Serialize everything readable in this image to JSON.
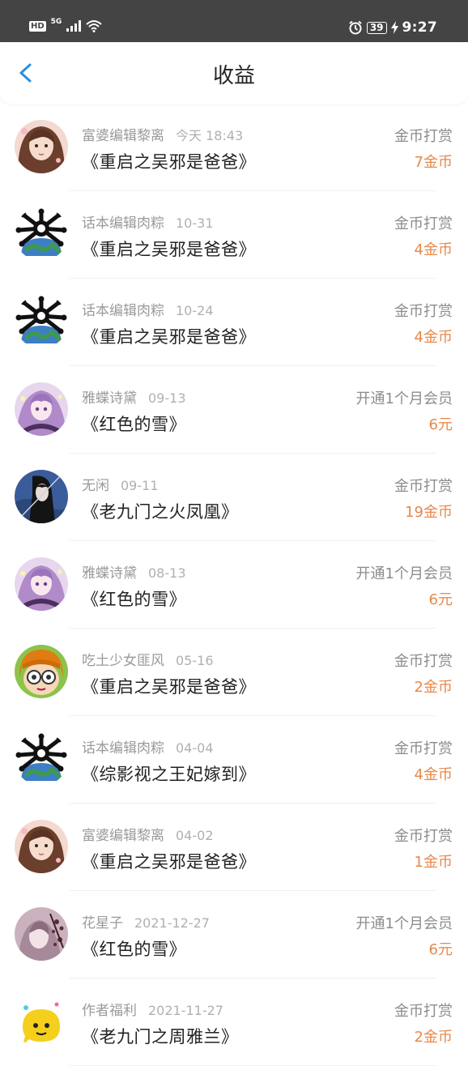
{
  "status_bar": {
    "hd": "HD",
    "network": "5G",
    "battery": "39",
    "time": "9:27"
  },
  "header": {
    "title": "收益"
  },
  "records": [
    {
      "name": "富婆编辑黎离",
      "date": "今天 18:43",
      "book": "《重启之吴邪是爸爸》",
      "type": "金币打赏",
      "amount": "7金币",
      "avatar": "portrait-girl"
    },
    {
      "name": "话本编辑肉粽",
      "date": "10-31",
      "book": "《重启之吴邪是爸爸》",
      "type": "金币打赏",
      "amount": "4金币",
      "avatar": "globe-skull"
    },
    {
      "name": "话本编辑肉粽",
      "date": "10-24",
      "book": "《重启之吴邪是爸爸》",
      "type": "金币打赏",
      "amount": "4金币",
      "avatar": "globe-skull"
    },
    {
      "name": "雅蝶诗黛",
      "date": "09-13",
      "book": "《红色的雪》",
      "type": "开通1个月会员",
      "amount": "6元",
      "avatar": "purple-anime"
    },
    {
      "name": "无闲",
      "date": "09-11",
      "book": "《老九门之火凤凰》",
      "type": "金币打赏",
      "amount": "19金币",
      "avatar": "dark-swordsman"
    },
    {
      "name": "雅蝶诗黛",
      "date": "08-13",
      "book": "《红色的雪》",
      "type": "开通1个月会员",
      "amount": "6元",
      "avatar": "purple-anime"
    },
    {
      "name": "吃土少女匪风",
      "date": "05-16",
      "book": "《重启之吴邪是爸爸》",
      "type": "金币打赏",
      "amount": "2金币",
      "avatar": "glasses-cartoon"
    },
    {
      "name": "话本编辑肉粽",
      "date": "04-04",
      "book": "《综影视之王妃嫁到》",
      "type": "金币打赏",
      "amount": "4金币",
      "avatar": "globe-skull"
    },
    {
      "name": "富婆编辑黎离",
      "date": "04-02",
      "book": "《重启之吴邪是爸爸》",
      "type": "金币打赏",
      "amount": "1金币",
      "avatar": "portrait-girl"
    },
    {
      "name": "花星子",
      "date": "2021-12-27",
      "book": "《红色的雪》",
      "type": "开通1个月会员",
      "amount": "6元",
      "avatar": "blossom-girl"
    },
    {
      "name": "作者福利",
      "date": "2021-11-27",
      "book": "《老九门之周雅兰》",
      "type": "金币打赏",
      "amount": "2金币",
      "avatar": "yellow-chat"
    }
  ],
  "colors": {
    "status_bar": "#444444",
    "accent_back": "#2a8fe0",
    "amount": "#e8884a"
  }
}
